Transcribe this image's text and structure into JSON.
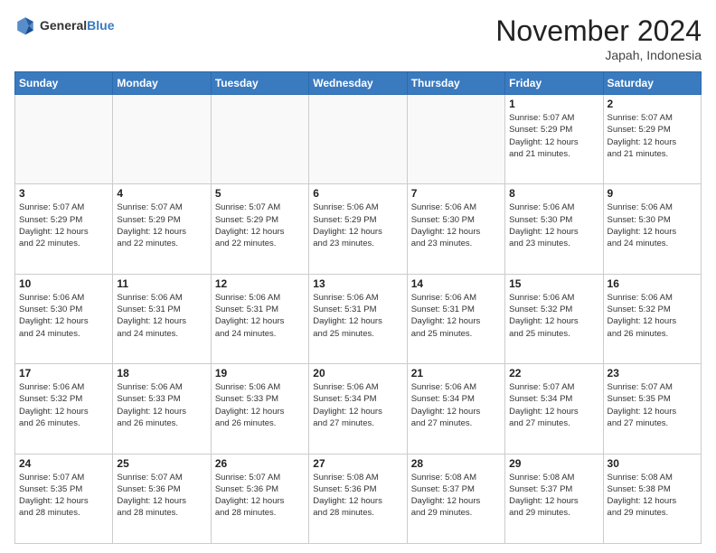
{
  "header": {
    "logo_general": "General",
    "logo_blue": "Blue",
    "month_title": "November 2024",
    "location": "Japah, Indonesia"
  },
  "days_of_week": [
    "Sunday",
    "Monday",
    "Tuesday",
    "Wednesday",
    "Thursday",
    "Friday",
    "Saturday"
  ],
  "weeks": [
    [
      {
        "day": "",
        "info": ""
      },
      {
        "day": "",
        "info": ""
      },
      {
        "day": "",
        "info": ""
      },
      {
        "day": "",
        "info": ""
      },
      {
        "day": "",
        "info": ""
      },
      {
        "day": "1",
        "info": "Sunrise: 5:07 AM\nSunset: 5:29 PM\nDaylight: 12 hours\nand 21 minutes."
      },
      {
        "day": "2",
        "info": "Sunrise: 5:07 AM\nSunset: 5:29 PM\nDaylight: 12 hours\nand 21 minutes."
      }
    ],
    [
      {
        "day": "3",
        "info": "Sunrise: 5:07 AM\nSunset: 5:29 PM\nDaylight: 12 hours\nand 22 minutes."
      },
      {
        "day": "4",
        "info": "Sunrise: 5:07 AM\nSunset: 5:29 PM\nDaylight: 12 hours\nand 22 minutes."
      },
      {
        "day": "5",
        "info": "Sunrise: 5:07 AM\nSunset: 5:29 PM\nDaylight: 12 hours\nand 22 minutes."
      },
      {
        "day": "6",
        "info": "Sunrise: 5:06 AM\nSunset: 5:29 PM\nDaylight: 12 hours\nand 23 minutes."
      },
      {
        "day": "7",
        "info": "Sunrise: 5:06 AM\nSunset: 5:30 PM\nDaylight: 12 hours\nand 23 minutes."
      },
      {
        "day": "8",
        "info": "Sunrise: 5:06 AM\nSunset: 5:30 PM\nDaylight: 12 hours\nand 23 minutes."
      },
      {
        "day": "9",
        "info": "Sunrise: 5:06 AM\nSunset: 5:30 PM\nDaylight: 12 hours\nand 24 minutes."
      }
    ],
    [
      {
        "day": "10",
        "info": "Sunrise: 5:06 AM\nSunset: 5:30 PM\nDaylight: 12 hours\nand 24 minutes."
      },
      {
        "day": "11",
        "info": "Sunrise: 5:06 AM\nSunset: 5:31 PM\nDaylight: 12 hours\nand 24 minutes."
      },
      {
        "day": "12",
        "info": "Sunrise: 5:06 AM\nSunset: 5:31 PM\nDaylight: 12 hours\nand 24 minutes."
      },
      {
        "day": "13",
        "info": "Sunrise: 5:06 AM\nSunset: 5:31 PM\nDaylight: 12 hours\nand 25 minutes."
      },
      {
        "day": "14",
        "info": "Sunrise: 5:06 AM\nSunset: 5:31 PM\nDaylight: 12 hours\nand 25 minutes."
      },
      {
        "day": "15",
        "info": "Sunrise: 5:06 AM\nSunset: 5:32 PM\nDaylight: 12 hours\nand 25 minutes."
      },
      {
        "day": "16",
        "info": "Sunrise: 5:06 AM\nSunset: 5:32 PM\nDaylight: 12 hours\nand 26 minutes."
      }
    ],
    [
      {
        "day": "17",
        "info": "Sunrise: 5:06 AM\nSunset: 5:32 PM\nDaylight: 12 hours\nand 26 minutes."
      },
      {
        "day": "18",
        "info": "Sunrise: 5:06 AM\nSunset: 5:33 PM\nDaylight: 12 hours\nand 26 minutes."
      },
      {
        "day": "19",
        "info": "Sunrise: 5:06 AM\nSunset: 5:33 PM\nDaylight: 12 hours\nand 26 minutes."
      },
      {
        "day": "20",
        "info": "Sunrise: 5:06 AM\nSunset: 5:34 PM\nDaylight: 12 hours\nand 27 minutes."
      },
      {
        "day": "21",
        "info": "Sunrise: 5:06 AM\nSunset: 5:34 PM\nDaylight: 12 hours\nand 27 minutes."
      },
      {
        "day": "22",
        "info": "Sunrise: 5:07 AM\nSunset: 5:34 PM\nDaylight: 12 hours\nand 27 minutes."
      },
      {
        "day": "23",
        "info": "Sunrise: 5:07 AM\nSunset: 5:35 PM\nDaylight: 12 hours\nand 27 minutes."
      }
    ],
    [
      {
        "day": "24",
        "info": "Sunrise: 5:07 AM\nSunset: 5:35 PM\nDaylight: 12 hours\nand 28 minutes."
      },
      {
        "day": "25",
        "info": "Sunrise: 5:07 AM\nSunset: 5:36 PM\nDaylight: 12 hours\nand 28 minutes."
      },
      {
        "day": "26",
        "info": "Sunrise: 5:07 AM\nSunset: 5:36 PM\nDaylight: 12 hours\nand 28 minutes."
      },
      {
        "day": "27",
        "info": "Sunrise: 5:08 AM\nSunset: 5:36 PM\nDaylight: 12 hours\nand 28 minutes."
      },
      {
        "day": "28",
        "info": "Sunrise: 5:08 AM\nSunset: 5:37 PM\nDaylight: 12 hours\nand 29 minutes."
      },
      {
        "day": "29",
        "info": "Sunrise: 5:08 AM\nSunset: 5:37 PM\nDaylight: 12 hours\nand 29 minutes."
      },
      {
        "day": "30",
        "info": "Sunrise: 5:08 AM\nSunset: 5:38 PM\nDaylight: 12 hours\nand 29 minutes."
      }
    ]
  ]
}
